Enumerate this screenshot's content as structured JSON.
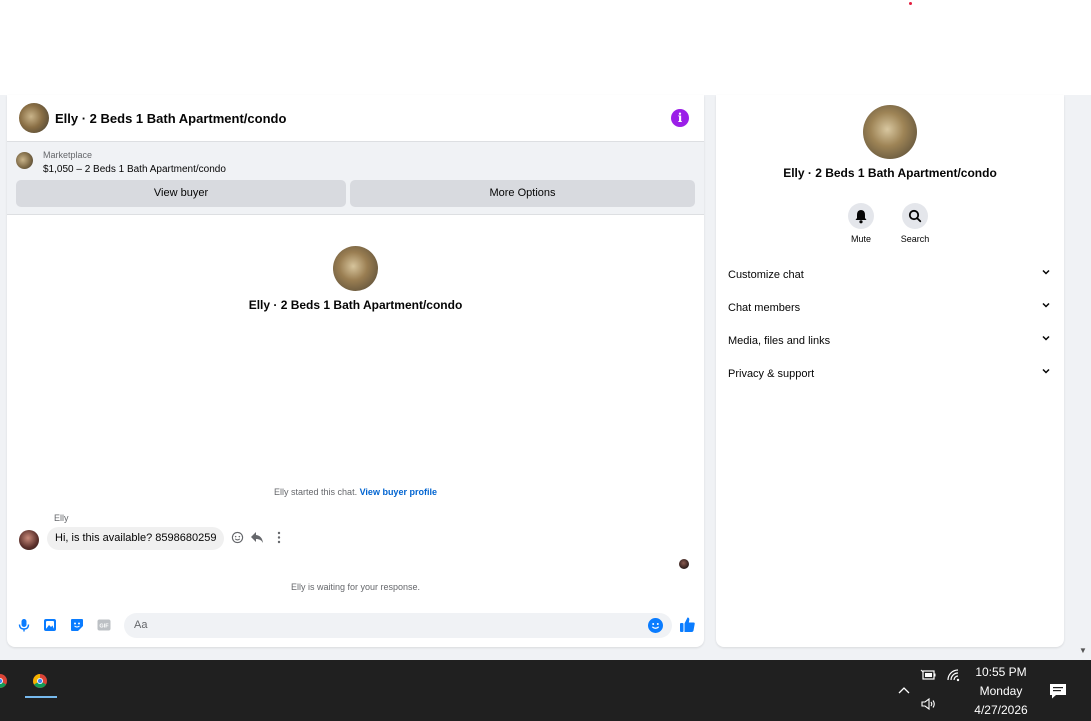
{
  "chat": {
    "header_title": "Elly · 2 Beds 1 Bath Apartment/condo",
    "info_icon": "i",
    "marketplace_label": "Marketplace",
    "listing": "$1,050 – 2 Beds 1 Bath Apartment/condo",
    "view_buyer": "View buyer",
    "more_options": "More Options",
    "center_title": "Elly · 2 Beds 1 Bath Apartment/condo",
    "started_text": "Elly started this chat.",
    "view_buyer_profile": "View buyer profile",
    "sender_name": "Elly",
    "message": "Hi, is this available? 8598680259",
    "waiting_text": "Elly is waiting for your response.",
    "input_placeholder": "Aa"
  },
  "sidebar": {
    "title": "Elly · 2 Beds 1 Bath Apartment/condo",
    "mute_label": "Mute",
    "search_label": "Search",
    "sections": [
      {
        "label": "Customize chat"
      },
      {
        "label": "Chat members"
      },
      {
        "label": "Media, files and links"
      },
      {
        "label": "Privacy & support"
      }
    ]
  },
  "taskbar": {
    "time": "10:55 PM",
    "day": "Monday",
    "date": "4/27/2026"
  },
  "colors": {
    "accent": "#0a7cff",
    "info_purple": "#9b1ee8",
    "taskbar": "#202020"
  },
  "icons": [
    "info-icon",
    "mic-icon",
    "photo-icon",
    "sticker-icon",
    "gif-icon",
    "emoji-icon",
    "like-icon",
    "bell-icon",
    "search-icon",
    "chevron-down-icon",
    "chrome-icon",
    "battery-icon",
    "wifi-icon",
    "volume-icon",
    "notification-icon"
  ]
}
